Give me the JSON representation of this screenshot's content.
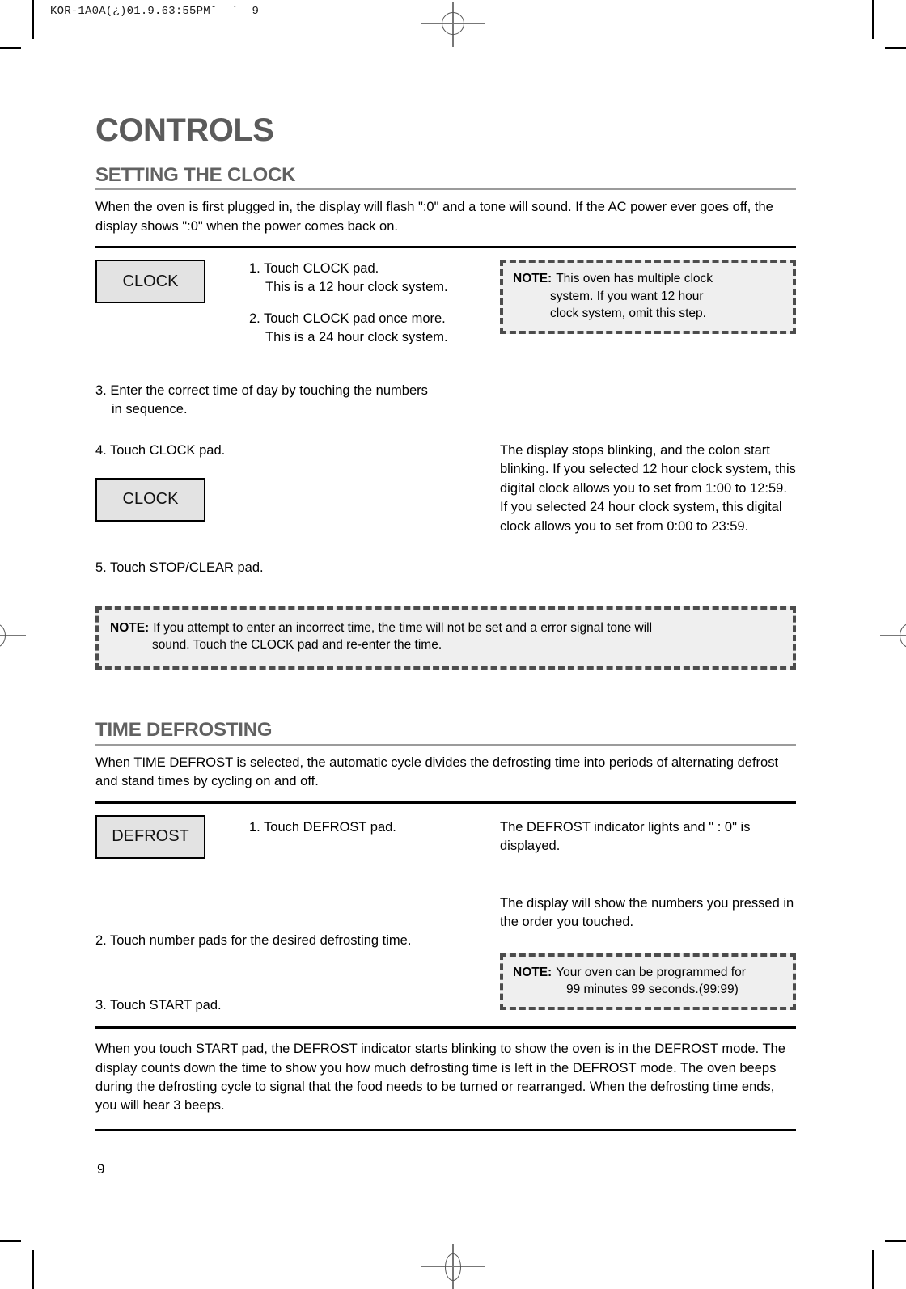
{
  "print_header": "KOR-1A0A(¿)01.9.63:55PM˘  `  9",
  "page_number": "9",
  "document": {
    "title": "CONTROLS"
  },
  "clock_section": {
    "heading": "SETTING THE CLOCK",
    "intro": "When the oven is first plugged in, the display will flash \":0\" and a tone will sound. If the AC power ever goes off, the display shows \":0\" when the power  comes back on.",
    "pad_1_label": "CLOCK",
    "pad_2_label": "CLOCK",
    "step_1": "1. Touch CLOCK pad.",
    "step_1_sub": "This is a 12 hour clock system.",
    "step_2": "2. Touch CLOCK pad once more.",
    "step_2_sub": "This is a 24 hour clock system.",
    "step_3": "3. Enter the correct time of day by touching the numbers",
    "step_3_sub": "in sequence.",
    "step_4": "4. Touch CLOCK pad.",
    "step_4_result": "The display stops blinking, and the colon start blinking. If you selected 12 hour clock system, this digital clock allows you to set from 1:00 to 12:59. If you selected 24 hour clock system, this digital clock allows you to set from 0:00 to 23:59.",
    "step_5": "5. Touch STOP/CLEAR pad.",
    "note_1": {
      "label": "NOTE:",
      "line_1": "This oven has multiple clock",
      "line_2": "system. If you want 12 hour",
      "line_3": "clock system, omit this step."
    },
    "note_2": {
      "label": "NOTE:",
      "line_1": "If you attempt to enter an incorrect time, the time will not be set and a error signal tone will",
      "line_2": "sound. Touch the CLOCK pad and re-enter the time."
    }
  },
  "defrost_section": {
    "heading": "TIME DEFROSTING",
    "intro": "When TIME DEFROST is selected, the automatic cycle divides the defrosting time into periods of alternating defrost and stand times by cycling on and off.",
    "pad_label": "DEFROST",
    "step_1": "1. Touch DEFROST pad.",
    "step_1_result": "The DEFROST indicator lights and \" : 0\" is displayed.",
    "step_2": "2. Touch number pads for the desired defrosting time.",
    "step_2_result": "The display will show the numbers you pressed in the order you touched.",
    "step_3": "3. Touch START pad.",
    "note": {
      "label": "NOTE:",
      "line_1": "Your oven can be programmed for",
      "line_2": "99 minutes 99 seconds.(99:99)"
    },
    "closing": "When you touch START pad, the DEFROST indicator starts blinking to show the oven is in the DEFROST mode. The display counts down the time to show you how much defrosting time is left in the DEFROST mode. The oven beeps during the defrosting cycle to signal that the food needs to be turned or rearranged. When the defrosting time ends, you will hear 3 beeps."
  },
  "colors": {
    "heading_gray": "#5b5b5b",
    "pad_fill": "#e3e3e3",
    "note_fill": "#efefef",
    "note_border": "#4c4c4c",
    "rule_gray": "#9b9b9b"
  }
}
